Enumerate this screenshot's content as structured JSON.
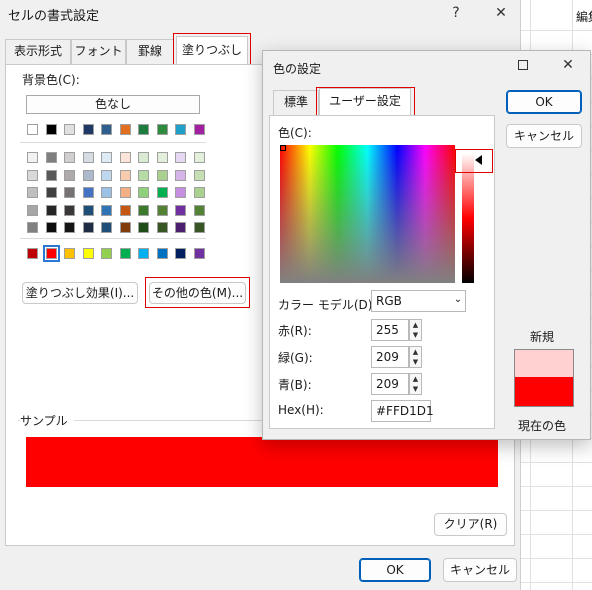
{
  "format_dialog": {
    "title": "セルの書式設定",
    "help": "?",
    "close": "✕",
    "tabs": [
      {
        "label": "表示形式"
      },
      {
        "label": "フォント"
      },
      {
        "label": "罫線"
      },
      {
        "label": "塗りつぶし",
        "active": true
      }
    ],
    "background_label": "背景色(C):",
    "background_label_key": "C",
    "no_color_button": "色なし",
    "fill_effects_button": "塗りつぶし効果(I)...",
    "more_colors_button": "その他の色(M)...",
    "sample_label": "サンプル",
    "sample_color": "#FF0000",
    "clear_button": "クリア(R)",
    "ok_button": "OK",
    "cancel_button": "キャンセル"
  },
  "palette": {
    "theme_top": [
      "#ffffff",
      "#000000",
      "#e7e6e6",
      "#44546a",
      "#4472c4",
      "#ed7d31",
      "#a5a5a5",
      "#ffc000",
      "#5b9bd5",
      "#70ad47"
    ],
    "theme_top_actual": [
      "#ffffff",
      "#000000",
      "#e0e0e0",
      "#1f3864",
      "#2e5e8e",
      "#e07020",
      "#1e7c3e",
      "#2e8b3e",
      "#20a0c8",
      "#a020a0"
    ],
    "theme_rows": [
      [
        "#f2f2f2",
        "#7f7f7f",
        "#d0cece",
        "#d6dce4",
        "#ddebf7",
        "#fce4d6",
        "#d8ead2",
        "#e2efda",
        "#e6d7f3",
        "#e2efda"
      ],
      [
        "#d9d9d9",
        "#595959",
        "#aeaaaa",
        "#acb9ca",
        "#bdd7ee",
        "#f8cbad",
        "#b4dca4",
        "#a9d08e",
        "#d5b4ea",
        "#c6e0b4"
      ],
      [
        "#bfbfbf",
        "#404040",
        "#757171",
        "#4472c4",
        "#9bc2e6",
        "#f4b084",
        "#8fd07a",
        "#00b050",
        "#c58ee0",
        "#a9d08e"
      ],
      [
        "#a6a6a6",
        "#262626",
        "#3a3838",
        "#1f4e78",
        "#2f75b5",
        "#c65911",
        "#3a7a2a",
        "#548235",
        "#7030a0",
        "#548235"
      ],
      [
        "#808080",
        "#0d0d0d",
        "#161616",
        "#1f2d44",
        "#1f4e78",
        "#833c0b",
        "#1e4d18",
        "#375623",
        "#4b1f6e",
        "#375623"
      ]
    ],
    "standard": [
      "#c00000",
      "#ff0000",
      "#ffc000",
      "#ffff00",
      "#92d050",
      "#00b050",
      "#00b0f0",
      "#0070c0",
      "#002060",
      "#7030a0"
    ]
  },
  "color_dialog": {
    "title": "色の設定",
    "tabs": [
      {
        "label": "標準"
      },
      {
        "label": "ユーザー設定",
        "active": true
      }
    ],
    "color_label": "色(C):",
    "color_model_label": "カラー モデル(D):",
    "color_model_value": "RGB",
    "red_label": "赤(R):",
    "red_value": "255",
    "green_label": "緑(G):",
    "green_value": "209",
    "blue_label": "青(B):",
    "blue_value": "209",
    "hex_label": "Hex(H):",
    "hex_value": "#FFD1D1",
    "ok_button": "OK",
    "cancel_button": "キャンセル",
    "new_label": "新規",
    "new_color": "#FFD1D1",
    "current_color": "#FF0000",
    "current_label": "現在の色"
  },
  "background_window": {
    "partial_text": "編集"
  }
}
